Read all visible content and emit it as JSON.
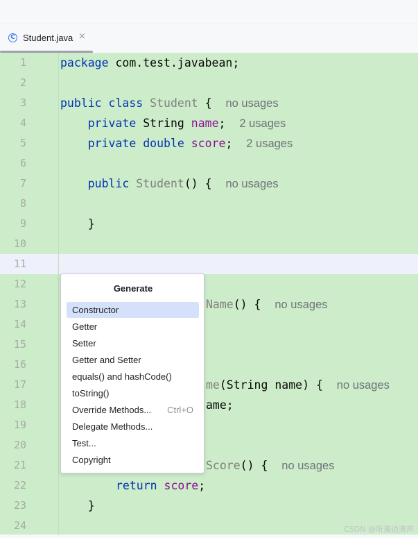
{
  "tab": {
    "icon": "class-icon",
    "icon_glyph": "C",
    "label": "Student.java",
    "close_glyph": "×"
  },
  "editor": {
    "lines": [
      {
        "n": "1"
      },
      {
        "n": "2"
      },
      {
        "n": "3"
      },
      {
        "n": "4"
      },
      {
        "n": "5"
      },
      {
        "n": "6"
      },
      {
        "n": "7"
      },
      {
        "n": "8"
      },
      {
        "n": "9"
      },
      {
        "n": "10"
      },
      {
        "n": "11"
      },
      {
        "n": "12"
      },
      {
        "n": "13"
      },
      {
        "n": "14"
      },
      {
        "n": "15"
      },
      {
        "n": "16"
      },
      {
        "n": "17"
      },
      {
        "n": "18"
      },
      {
        "n": "19"
      },
      {
        "n": "20"
      },
      {
        "n": "21"
      },
      {
        "n": "22"
      },
      {
        "n": "23"
      },
      {
        "n": "24"
      }
    ],
    "code": {
      "l1_kw": "package",
      "l1_rest": " com.test.javabean;",
      "l3_kw1": "public",
      "l3_kw2": "class",
      "l3_cls": "Student",
      "l3_brace": " {",
      "l3_hint": "no usages",
      "l4_kw": "private",
      "l4_type": "String",
      "l4_fld": "name",
      "l4_semi": ";",
      "l4_hint": "2 usages",
      "l5_kw1": "private",
      "l5_kw2": "double",
      "l5_fld": "score",
      "l5_semi": ";",
      "l5_hint": "2 usages",
      "l7_kw": "public",
      "l7_cls": "Student",
      "l7_rest": "() {",
      "l7_hint": "no usages",
      "l9_brace": "}",
      "l13_cls": "Name",
      "l13_rest": "() {",
      "l13_hint": "no usages",
      "l17_cls": "me",
      "l17_rest": "(String name) {",
      "l17_hint": "no usages",
      "l18_rest": "ame;",
      "l21_cls": "Score",
      "l21_rest": "() {",
      "l21_hint": "no usages",
      "l22_kw": "return",
      "l22_fld": "score",
      "l22_semi": ";",
      "l23_brace": "}"
    }
  },
  "popup": {
    "title": "Generate",
    "items": [
      {
        "label": "Constructor",
        "shortcut": ""
      },
      {
        "label": "Getter",
        "shortcut": ""
      },
      {
        "label": "Setter",
        "shortcut": ""
      },
      {
        "label": "Getter and Setter",
        "shortcut": ""
      },
      {
        "label": "equals() and hashCode()",
        "shortcut": ""
      },
      {
        "label": "toString()",
        "shortcut": ""
      },
      {
        "label": "Override Methods...",
        "shortcut": "Ctrl+O"
      },
      {
        "label": "Delegate Methods...",
        "shortcut": ""
      },
      {
        "label": "Test...",
        "shortcut": ""
      },
      {
        "label": "Copyright",
        "shortcut": ""
      }
    ],
    "selected_index": 0
  },
  "watermark": "CSDN @听海边涛声",
  "colors": {
    "editor_bg": "#cdecc9",
    "keyword": "#0033b3",
    "field": "#871094",
    "selection": "#d5e1fb"
  }
}
